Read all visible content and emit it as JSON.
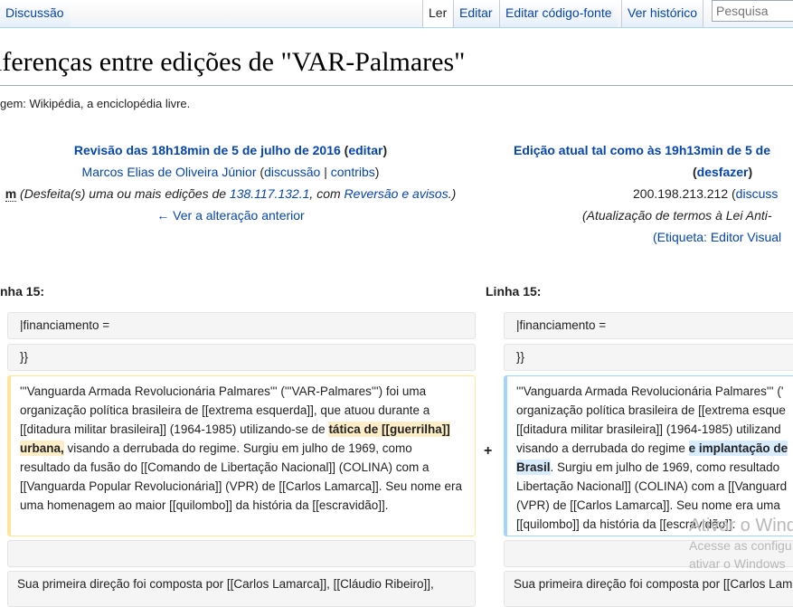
{
  "tabs": {
    "discussion": "Discussão",
    "read": "Ler",
    "edit": "Editar",
    "edit_source": "Editar código-fonte",
    "history": "Ver histórico"
  },
  "search": {
    "placeholder": "Pesquisa"
  },
  "page_title": "iferenças entre edições de \"VAR-Palmares\"",
  "origin": "gem: Wikipédia, a enciclopédia livre.",
  "left": {
    "revision_title": "Revisão das 18h18min de 5 de julho de 2016",
    "edit_link": "editar",
    "user": "Marcos Elias de Oliveira Júnior",
    "talk_link": "discussão",
    "contribs_link": "contribs",
    "minor_flag": "m",
    "summary_before": "(Desfeita(s) uma ou mais edições de ",
    "summary_ip": "138.117.132.1",
    "summary_mid": ", com ",
    "summary_link": "Reversão e avisos",
    "summary_end": ".)",
    "prev_link": "← Ver a alteração anterior",
    "line_label": "nha 15:",
    "rows": {
      "row1": "|financiamento =",
      "row2": "}}",
      "paragraph_a": "'''Vanguarda Armada Revolucionária Palmares''' ('''VAR-Palmares''') foi uma organização política brasileira de [[extrema esquerda]], que atuou durante a [[ditadura militar brasileira]] (1964-1985) utilizando-se de ",
      "paragraph_del": "tática de [[guerrilha]] urbana,",
      "paragraph_b": " visando a derrubada do regime. Surgiu em julho de 1969, como resultado da fusão do [[Comando de Libertação Nacional]] (COLINA) com a [[Vanguarda Popular Revolucionária]] (VPR) de [[Carlos Lamarca]]. Seu nome era uma homenagem ao maior [[quilombo]] da história da [[escravidão]].",
      "row_last": "Sua primeira direção foi composta por [[Carlos Lamarca]], [[Cláudio Ribeiro]],"
    }
  },
  "right": {
    "revision_title": "Edição atual tal como às 19h13min de 5 de",
    "undo_link": "desfazer",
    "user": "200.198.213.212",
    "talk_link": "discuss",
    "summary": "(Atualização de termos à Lei Anti-",
    "tag_before": "(Etiqueta: ",
    "tag_link": "Editor Visual",
    "line_label": "Linha 15:",
    "rows": {
      "row1": "|financiamento =",
      "row2": "}}",
      "lines": [
        "'''Vanguarda Armada Revolucionária Palmares''' ('",
        "organização política brasileira de [[extrema esque",
        "[[ditadura militar brasileira]] (1964-1985) utilizand"
      ],
      "line4_before": "visando a derrubada do regime ",
      "line4_add": "e implantação de",
      "line5_add": "Brasil",
      "line5_after": ". Surgiu em julho de 1969, como resultado",
      "lines_after": [
        "Libertação Nacional]] (COLINA) com a [[Vanguard",
        "(VPR) de [[Carlos Lamarca]]. Seu nome era uma",
        "[[quilombo]] da história da [[escravidão]]."
      ],
      "row_last": "Sua primeira direção foi composta por [[Carlos Lamarc"
    }
  },
  "diff_marker": "+",
  "watermark": {
    "line1": "Ativar o Wind",
    "line2": "Acesse as configu",
    "line3": "ativar o Windows"
  }
}
